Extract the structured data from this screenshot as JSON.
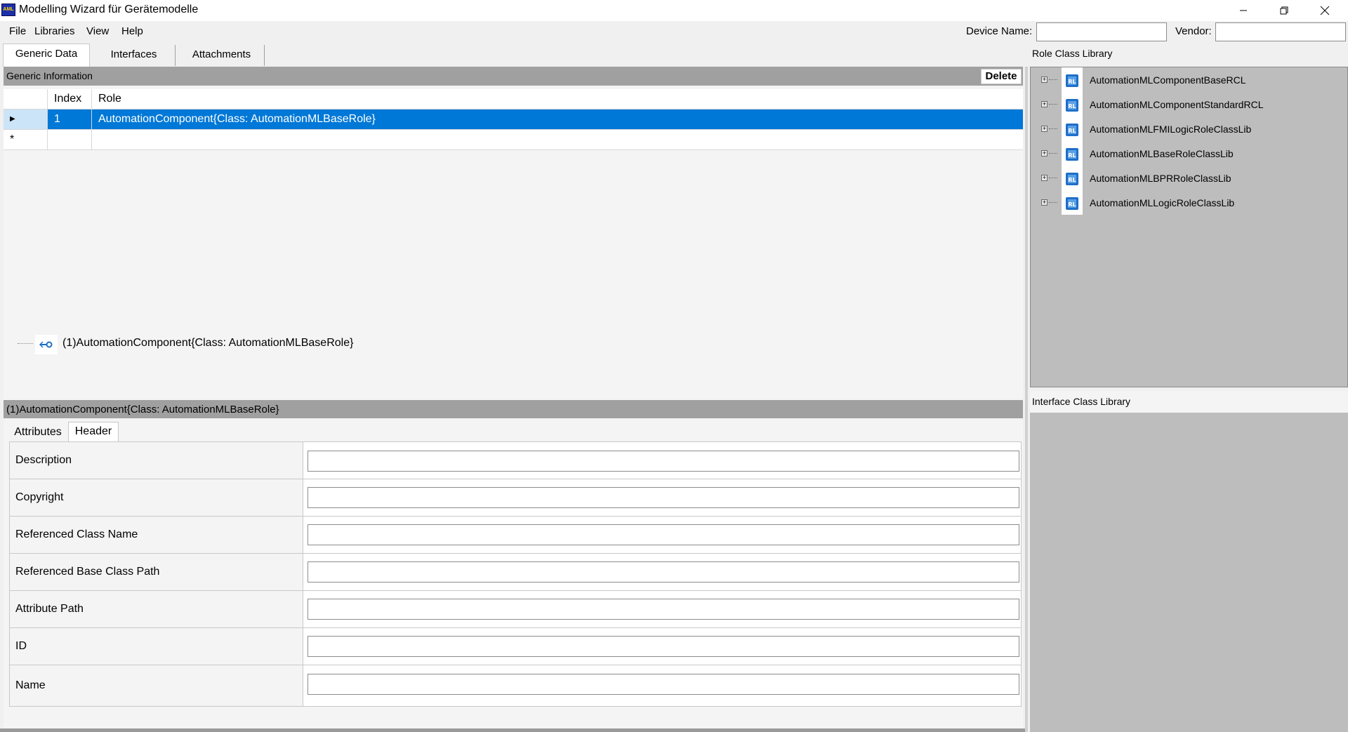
{
  "window": {
    "title": "Modelling Wizard für Gerätemodelle",
    "icon_text": "AML"
  },
  "menu": {
    "file": "File",
    "libraries": "Libraries",
    "view": "View",
    "help": "Help"
  },
  "header_fields": {
    "device_name_label": "Device Name:",
    "device_name_value": "",
    "vendor_label": "Vendor:",
    "vendor_value": ""
  },
  "tabs": {
    "generic_data": "Generic Data",
    "interfaces": "Interfaces",
    "attachments": "Attachments"
  },
  "generic_info": {
    "title": "Generic Information",
    "delete_label": "Delete",
    "columns": {
      "index": "Index",
      "role": "Role"
    },
    "rows": [
      {
        "marker": "▶",
        "index": "1",
        "role": "AutomationComponent{Class:  AutomationMLBaseRole}"
      }
    ],
    "new_row_marker": "*"
  },
  "tree_node": {
    "label": "(1)AutomationComponent{Class:  AutomationMLBaseRole}"
  },
  "selected": {
    "title": "(1)AutomationComponent{Class:  AutomationMLBaseRole}"
  },
  "detail_tabs": {
    "attributes": "Attributes",
    "header": "Header"
  },
  "form": {
    "description": {
      "label": "Description",
      "value": ""
    },
    "copyright": {
      "label": "Copyright",
      "value": ""
    },
    "ref_class_name": {
      "label": "Referenced Class Name",
      "value": ""
    },
    "ref_base_class_path": {
      "label": "Referenced Base Class Path",
      "value": ""
    },
    "attribute_path": {
      "label": "Attribute Path",
      "value": ""
    },
    "id": {
      "label": "ID",
      "value": ""
    },
    "name": {
      "label": "Name",
      "value": ""
    }
  },
  "role_class_library": {
    "title": "Role Class Library",
    "items": [
      {
        "label": "AutomationMLComponentBaseRCL"
      },
      {
        "label": "AutomationMLComponentStandardRCL"
      },
      {
        "label": "AutomationMLFMILogicRoleClassLib"
      },
      {
        "label": "AutomationMLBaseRoleClassLib"
      },
      {
        "label": "AutomationMLBPRRoleClassLib"
      },
      {
        "label": "AutomationMLLogicRoleClassLib"
      }
    ]
  },
  "interface_class_library": {
    "title": "Interface Class Library"
  },
  "colors": {
    "selection": "#0078d7",
    "panel_header": "#a0a0a0",
    "library_bg": "#bdbdbd",
    "library_icon": "#1e6fc8"
  },
  "icons": {
    "tree_node": "role-node-icon",
    "library": "role-class-lib-icon"
  }
}
